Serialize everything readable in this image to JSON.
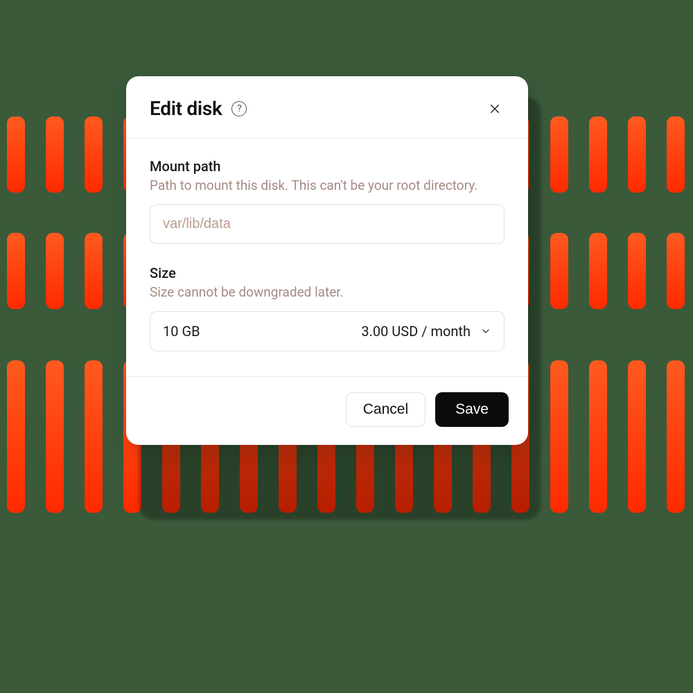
{
  "modal": {
    "title": "Edit disk",
    "fields": {
      "mount": {
        "label": "Mount path",
        "help": "Path to mount this disk. This can't be your root directory.",
        "placeholder": "var/lib/data",
        "value": ""
      },
      "size": {
        "label": "Size",
        "help": "Size cannot be downgraded later.",
        "selected_size": "10 GB",
        "selected_price": "3.00 USD / month"
      }
    },
    "buttons": {
      "cancel": "Cancel",
      "save": "Save"
    }
  }
}
